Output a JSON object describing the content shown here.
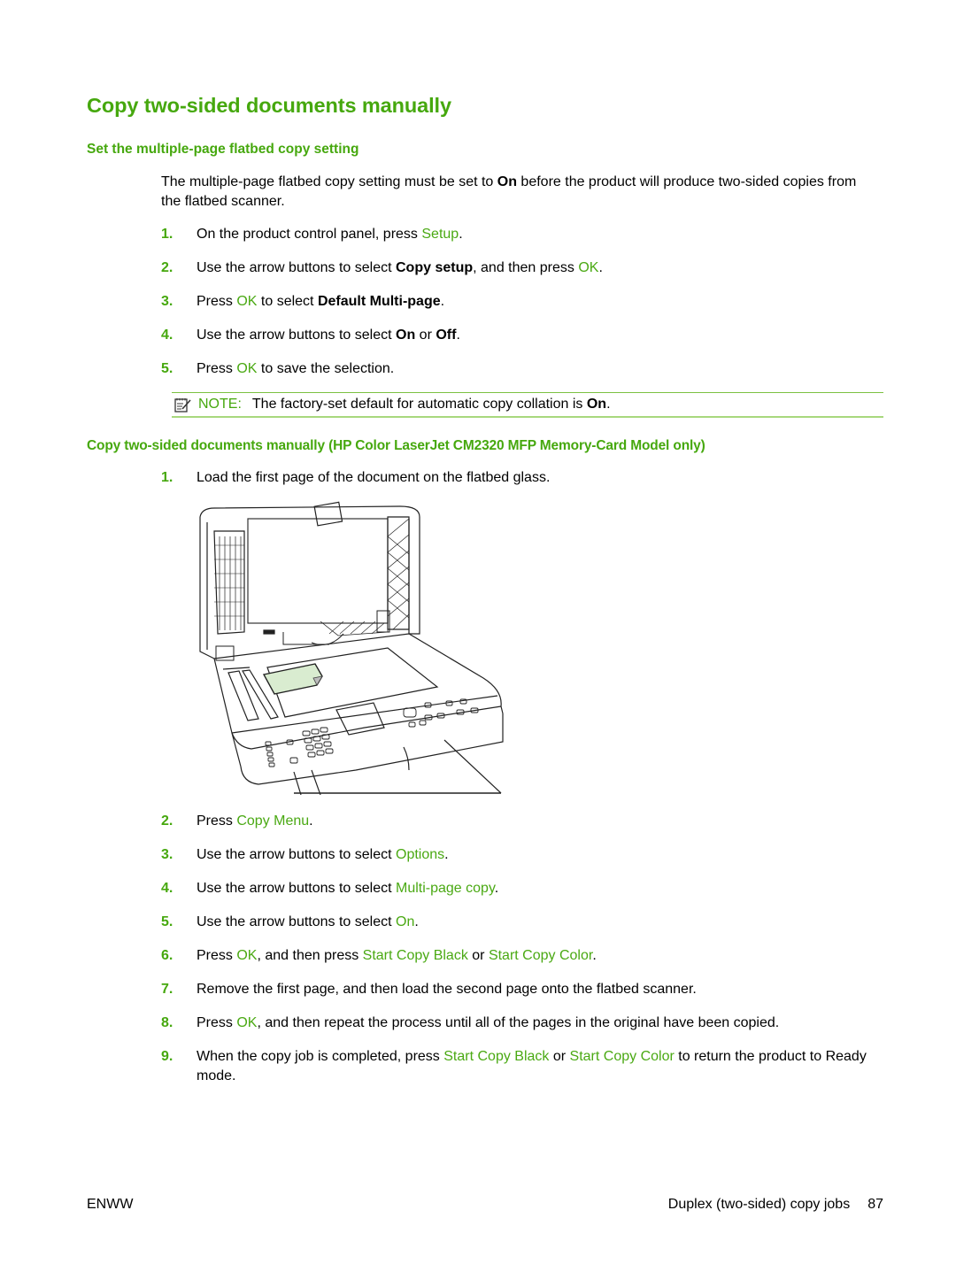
{
  "page": {
    "title": "Copy two-sided documents manually",
    "section1": {
      "heading": "Set the multiple-page flatbed copy setting",
      "intro": {
        "pre": "The multiple-page flatbed copy setting must be set to ",
        "bold": "On",
        "post": " before the product will produce two-sided copies from the flatbed scanner."
      },
      "steps": [
        {
          "num": "1.",
          "parts": [
            {
              "t": "On the product control panel, press "
            },
            {
              "t": "Setup",
              "s": "green"
            },
            {
              "t": "."
            }
          ]
        },
        {
          "num": "2.",
          "parts": [
            {
              "t": "Use the arrow buttons to select "
            },
            {
              "t": "Copy setup",
              "s": "bold"
            },
            {
              "t": ", and then press "
            },
            {
              "t": "OK",
              "s": "green"
            },
            {
              "t": "."
            }
          ]
        },
        {
          "num": "3.",
          "parts": [
            {
              "t": "Press "
            },
            {
              "t": "OK",
              "s": "green"
            },
            {
              "t": " to select "
            },
            {
              "t": "Default Multi-page",
              "s": "bold"
            },
            {
              "t": "."
            }
          ]
        },
        {
          "num": "4.",
          "parts": [
            {
              "t": "Use the arrow buttons to select "
            },
            {
              "t": "On",
              "s": "bold"
            },
            {
              "t": " or "
            },
            {
              "t": "Off",
              "s": "bold"
            },
            {
              "t": "."
            }
          ]
        },
        {
          "num": "5.",
          "parts": [
            {
              "t": "Press "
            },
            {
              "t": "OK",
              "s": "green"
            },
            {
              "t": " to save the selection."
            }
          ]
        }
      ],
      "note": {
        "icon": "note-pad-icon",
        "label": "NOTE:",
        "pre": "The factory-set default for automatic copy collation is ",
        "bold": "On",
        "post": "."
      }
    },
    "section2": {
      "heading": "Copy two-sided documents manually (HP Color LaserJet CM2320 MFP Memory-Card Model only)",
      "steps": [
        {
          "num": "1.",
          "parts": [
            {
              "t": "Load the first page of the document on the flatbed glass."
            }
          ]
        },
        {
          "num": "2.",
          "parts": [
            {
              "t": "Press "
            },
            {
              "t": "Copy Menu",
              "s": "green"
            },
            {
              "t": "."
            }
          ]
        },
        {
          "num": "3.",
          "parts": [
            {
              "t": "Use the arrow buttons to select "
            },
            {
              "t": "Options",
              "s": "green"
            },
            {
              "t": "."
            }
          ]
        },
        {
          "num": "4.",
          "parts": [
            {
              "t": "Use the arrow buttons to select "
            },
            {
              "t": "Multi-page copy",
              "s": "green"
            },
            {
              "t": "."
            }
          ]
        },
        {
          "num": "5.",
          "parts": [
            {
              "t": "Use the arrow buttons to select "
            },
            {
              "t": "On",
              "s": "green"
            },
            {
              "t": "."
            }
          ]
        },
        {
          "num": "6.",
          "parts": [
            {
              "t": "Press "
            },
            {
              "t": "OK",
              "s": "green"
            },
            {
              "t": ", and then press "
            },
            {
              "t": "Start Copy Black",
              "s": "green"
            },
            {
              "t": " or "
            },
            {
              "t": "Start Copy Color",
              "s": "green"
            },
            {
              "t": "."
            }
          ]
        },
        {
          "num": "7.",
          "parts": [
            {
              "t": "Remove the first page, and then load the second page onto the flatbed scanner."
            }
          ]
        },
        {
          "num": "8.",
          "parts": [
            {
              "t": "Press "
            },
            {
              "t": "OK",
              "s": "green"
            },
            {
              "t": ", and then repeat the process until all of the pages in the original have been copied."
            }
          ]
        },
        {
          "num": "9.",
          "parts": [
            {
              "t": "When the copy job is completed, press "
            },
            {
              "t": "Start Copy Black",
              "s": "green"
            },
            {
              "t": " or "
            },
            {
              "t": "Start Copy Color",
              "s": "green"
            },
            {
              "t": " to return the product to Ready mode."
            }
          ]
        }
      ],
      "figure": {
        "description": "Flatbed scanner open with a page placed on the glass",
        "icon": "printer-flatbed-illustration"
      }
    },
    "footer": {
      "left": "ENWW",
      "section": "Duplex (two-sided) copy jobs",
      "page_number": "87"
    },
    "colors": {
      "accent": "#46a80e",
      "link": "#4aa913",
      "rule": "#7cc242"
    }
  }
}
